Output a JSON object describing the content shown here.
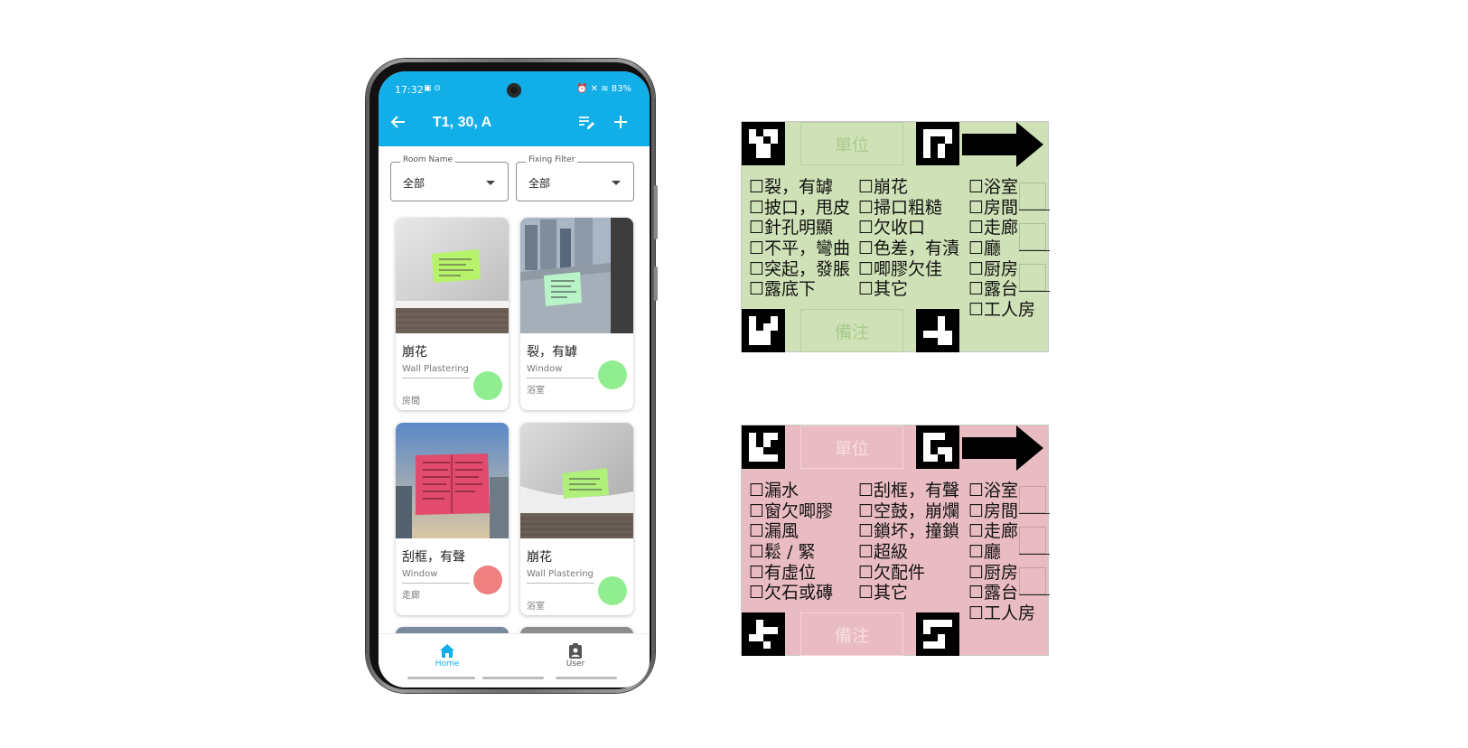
{
  "app": {
    "status_time": "17:32",
    "status_left_icons": "▣ ⊙",
    "status_right": "⏰ ✕ ≋ 83%",
    "title": "T1, 30, A",
    "filters": [
      {
        "label": "Room Name",
        "value": "全部"
      },
      {
        "label": "Fixing Filter",
        "value": "全部"
      }
    ],
    "cards": [
      {
        "title": "崩花",
        "category": "Wall Plastering",
        "room": "房間",
        "status_color": "#90ee90"
      },
      {
        "title": "裂，有罅",
        "category": "Window",
        "room": "浴室",
        "status_color": "#90ee90"
      },
      {
        "title": "刮框，有聲",
        "category": "Window",
        "room": "走廊",
        "status_color": "#f08080"
      },
      {
        "title": "崩花",
        "category": "Wall Plastering",
        "room": "浴室",
        "status_color": "#90ee90"
      }
    ],
    "nav": [
      {
        "label": "Home",
        "icon": "home-icon",
        "active": true
      },
      {
        "label": "User",
        "icon": "user-badge-icon",
        "active": false
      }
    ],
    "accent": "#12aee8"
  },
  "sheets": [
    {
      "color": "#cfe1b6",
      "unit_label": "單位",
      "remark_label": "備注",
      "col1": [
        "☐裂，有罅",
        "☐披口，甩皮",
        "☐針孔明顯",
        "☐不平，彎曲",
        "☐突起，發脹",
        "☐露底下"
      ],
      "col2": [
        "☐崩花",
        "☐掃口粗糙",
        "☐欠收口",
        "☐色差，有漬",
        "☐唧膠欠佳",
        "☐其它"
      ],
      "rooms": [
        "☐浴室",
        "☐房間",
        "☐走廊",
        "☐廳",
        "☐厨房",
        "☐露台",
        "☐工人房"
      ]
    },
    {
      "color": "#e9bcc3",
      "unit_label": "單位",
      "remark_label": "備注",
      "col1": [
        "☐漏水",
        "☐窗欠唧膠",
        "☐漏風",
        "☐鬆 / 緊",
        "☐有虛位",
        "☐欠石或磚"
      ],
      "col2": [
        "☐刮框，有聲",
        "☐空鼓，崩爛",
        "☐鎖坏，撞鎖",
        "☐超級",
        "☐欠配件",
        "☐其它"
      ],
      "rooms": [
        "☐浴室",
        "☐房間",
        "☐走廊",
        "☐廳",
        "☐厨房",
        "☐露台",
        "☐工人房"
      ]
    }
  ]
}
